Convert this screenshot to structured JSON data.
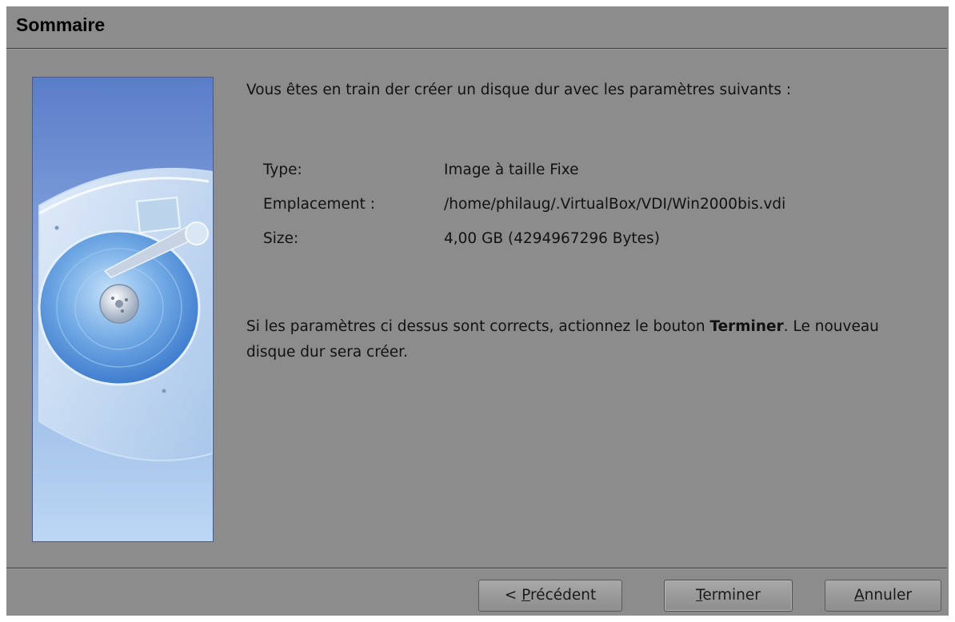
{
  "header": {
    "title": "Sommaire"
  },
  "intro": {
    "text": "Vous êtes en train der créer un disque dur avec les paramètres suivants :"
  },
  "details": [
    {
      "label": "Type:",
      "value": "Image à taille Fixe"
    },
    {
      "label": "Emplacement :",
      "value": "/home/philaug/.VirtualBox/VDI/Win2000bis.vdi"
    },
    {
      "label": "Size:",
      "value": "4,00 GB (4294967296 Bytes)"
    }
  ],
  "confirm": {
    "before": "Si les paramètres ci dessus sont corrects, actionnez le bouton ",
    "emphasis": "Terminer",
    "after": ". Le nouveau disque dur sera créer."
  },
  "buttons": {
    "prev": {
      "prefix": "< ",
      "mnemonic": "P",
      "rest": "récédent"
    },
    "finish": {
      "prefix": "",
      "mnemonic": "T",
      "rest": "erminer"
    },
    "cancel": {
      "prefix": "",
      "mnemonic": "A",
      "rest": "nnuler"
    }
  },
  "side_image": {
    "icon": "hard-disk-icon"
  },
  "colors": {
    "dialog_background": "#8c8c8c",
    "side_gradient_top": "#5a7dc8",
    "side_gradient_bottom": "#bcd7f4",
    "text": "#121212"
  }
}
